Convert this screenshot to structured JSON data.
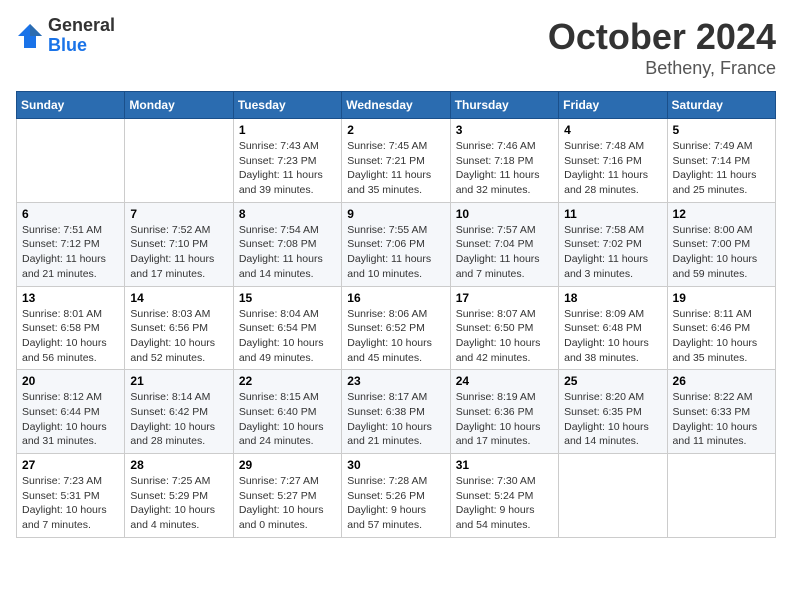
{
  "header": {
    "logo_general": "General",
    "logo_blue": "Blue",
    "month_title": "October 2024",
    "location": "Betheny, France"
  },
  "calendar": {
    "days_of_week": [
      "Sunday",
      "Monday",
      "Tuesday",
      "Wednesday",
      "Thursday",
      "Friday",
      "Saturday"
    ],
    "weeks": [
      [
        {
          "day": "",
          "info": ""
        },
        {
          "day": "",
          "info": ""
        },
        {
          "day": "1",
          "info": "Sunrise: 7:43 AM\nSunset: 7:23 PM\nDaylight: 11 hours and 39 minutes."
        },
        {
          "day": "2",
          "info": "Sunrise: 7:45 AM\nSunset: 7:21 PM\nDaylight: 11 hours and 35 minutes."
        },
        {
          "day": "3",
          "info": "Sunrise: 7:46 AM\nSunset: 7:18 PM\nDaylight: 11 hours and 32 minutes."
        },
        {
          "day": "4",
          "info": "Sunrise: 7:48 AM\nSunset: 7:16 PM\nDaylight: 11 hours and 28 minutes."
        },
        {
          "day": "5",
          "info": "Sunrise: 7:49 AM\nSunset: 7:14 PM\nDaylight: 11 hours and 25 minutes."
        }
      ],
      [
        {
          "day": "6",
          "info": "Sunrise: 7:51 AM\nSunset: 7:12 PM\nDaylight: 11 hours and 21 minutes."
        },
        {
          "day": "7",
          "info": "Sunrise: 7:52 AM\nSunset: 7:10 PM\nDaylight: 11 hours and 17 minutes."
        },
        {
          "day": "8",
          "info": "Sunrise: 7:54 AM\nSunset: 7:08 PM\nDaylight: 11 hours and 14 minutes."
        },
        {
          "day": "9",
          "info": "Sunrise: 7:55 AM\nSunset: 7:06 PM\nDaylight: 11 hours and 10 minutes."
        },
        {
          "day": "10",
          "info": "Sunrise: 7:57 AM\nSunset: 7:04 PM\nDaylight: 11 hours and 7 minutes."
        },
        {
          "day": "11",
          "info": "Sunrise: 7:58 AM\nSunset: 7:02 PM\nDaylight: 11 hours and 3 minutes."
        },
        {
          "day": "12",
          "info": "Sunrise: 8:00 AM\nSunset: 7:00 PM\nDaylight: 10 hours and 59 minutes."
        }
      ],
      [
        {
          "day": "13",
          "info": "Sunrise: 8:01 AM\nSunset: 6:58 PM\nDaylight: 10 hours and 56 minutes."
        },
        {
          "day": "14",
          "info": "Sunrise: 8:03 AM\nSunset: 6:56 PM\nDaylight: 10 hours and 52 minutes."
        },
        {
          "day": "15",
          "info": "Sunrise: 8:04 AM\nSunset: 6:54 PM\nDaylight: 10 hours and 49 minutes."
        },
        {
          "day": "16",
          "info": "Sunrise: 8:06 AM\nSunset: 6:52 PM\nDaylight: 10 hours and 45 minutes."
        },
        {
          "day": "17",
          "info": "Sunrise: 8:07 AM\nSunset: 6:50 PM\nDaylight: 10 hours and 42 minutes."
        },
        {
          "day": "18",
          "info": "Sunrise: 8:09 AM\nSunset: 6:48 PM\nDaylight: 10 hours and 38 minutes."
        },
        {
          "day": "19",
          "info": "Sunrise: 8:11 AM\nSunset: 6:46 PM\nDaylight: 10 hours and 35 minutes."
        }
      ],
      [
        {
          "day": "20",
          "info": "Sunrise: 8:12 AM\nSunset: 6:44 PM\nDaylight: 10 hours and 31 minutes."
        },
        {
          "day": "21",
          "info": "Sunrise: 8:14 AM\nSunset: 6:42 PM\nDaylight: 10 hours and 28 minutes."
        },
        {
          "day": "22",
          "info": "Sunrise: 8:15 AM\nSunset: 6:40 PM\nDaylight: 10 hours and 24 minutes."
        },
        {
          "day": "23",
          "info": "Sunrise: 8:17 AM\nSunset: 6:38 PM\nDaylight: 10 hours and 21 minutes."
        },
        {
          "day": "24",
          "info": "Sunrise: 8:19 AM\nSunset: 6:36 PM\nDaylight: 10 hours and 17 minutes."
        },
        {
          "day": "25",
          "info": "Sunrise: 8:20 AM\nSunset: 6:35 PM\nDaylight: 10 hours and 14 minutes."
        },
        {
          "day": "26",
          "info": "Sunrise: 8:22 AM\nSunset: 6:33 PM\nDaylight: 10 hours and 11 minutes."
        }
      ],
      [
        {
          "day": "27",
          "info": "Sunrise: 7:23 AM\nSunset: 5:31 PM\nDaylight: 10 hours and 7 minutes."
        },
        {
          "day": "28",
          "info": "Sunrise: 7:25 AM\nSunset: 5:29 PM\nDaylight: 10 hours and 4 minutes."
        },
        {
          "day": "29",
          "info": "Sunrise: 7:27 AM\nSunset: 5:27 PM\nDaylight: 10 hours and 0 minutes."
        },
        {
          "day": "30",
          "info": "Sunrise: 7:28 AM\nSunset: 5:26 PM\nDaylight: 9 hours and 57 minutes."
        },
        {
          "day": "31",
          "info": "Sunrise: 7:30 AM\nSunset: 5:24 PM\nDaylight: 9 hours and 54 minutes."
        },
        {
          "day": "",
          "info": ""
        },
        {
          "day": "",
          "info": ""
        }
      ]
    ]
  }
}
